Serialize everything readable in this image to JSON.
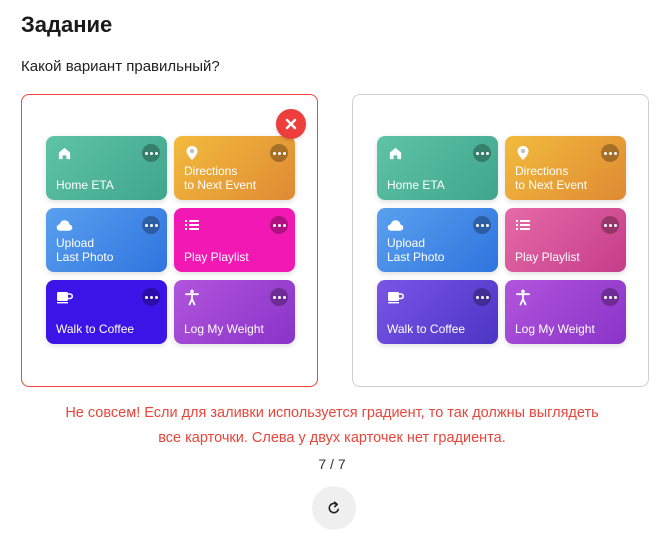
{
  "header": {
    "title": "Задание"
  },
  "question": "Какой вариант правильный?",
  "options": [
    {
      "state": "wrong",
      "badge_icon": "close-icon",
      "cards": [
        {
          "label": "Home ETA",
          "icon": "home-icon",
          "bg": "linear-gradient(135deg,#5fc4a6,#3fa58c)"
        },
        {
          "label": "Directions\nto Next Event",
          "icon": "location-pin-icon",
          "bg": "linear-gradient(135deg,#f2bb3d,#df8a33)"
        },
        {
          "label": "Upload\nLast Photo",
          "icon": "cloud-icon",
          "bg": "linear-gradient(135deg,#5aa0ee,#2f74de)"
        },
        {
          "label": "Play Playlist",
          "icon": "list-icon",
          "bg": "#f218b4"
        },
        {
          "label": "Walk to Coffee",
          "icon": "coffee-cup-icon",
          "bg": "#3c14e8"
        },
        {
          "label": "Log My Weight",
          "icon": "person-icon",
          "bg": "linear-gradient(135deg,#b055dc,#8a33c8)"
        }
      ]
    },
    {
      "state": "unselected",
      "cards": [
        {
          "label": "Home ETA",
          "icon": "home-icon",
          "bg": "linear-gradient(135deg,#5fc4a6,#3fa58c)"
        },
        {
          "label": "Directions\nto Next Event",
          "icon": "location-pin-icon",
          "bg": "linear-gradient(135deg,#f2bb3d,#df8a33)"
        },
        {
          "label": "Upload\nLast Photo",
          "icon": "cloud-icon",
          "bg": "linear-gradient(135deg,#5aa0ee,#2f74de)"
        },
        {
          "label": "Play Playlist",
          "icon": "list-icon",
          "bg": "linear-gradient(135deg,#e56aa8,#c53d89)"
        },
        {
          "label": "Walk to Coffee",
          "icon": "coffee-cup-icon",
          "bg": "linear-gradient(135deg,#7a55e6,#4b35c4)"
        },
        {
          "label": "Log My Weight",
          "icon": "person-icon",
          "bg": "linear-gradient(135deg,#b055dc,#8a33c8)"
        }
      ]
    }
  ],
  "feedback": {
    "line1": "Не совсем! Если для заливки используется градиент, то так должны выглядеть",
    "line2": "все карточки. Слева у двух карточек нет градиента."
  },
  "progress": "7 / 7",
  "retry_icon": "refresh-icon",
  "colors": {
    "error": "#e8453c",
    "badge": "#ee3d3d"
  }
}
